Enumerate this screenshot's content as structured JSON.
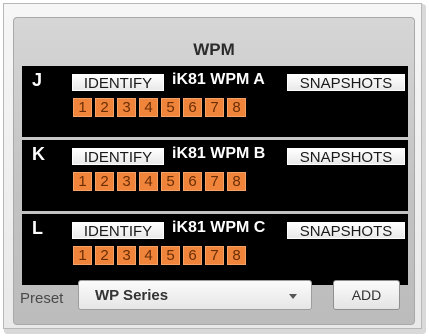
{
  "panel": {
    "title": "WPM"
  },
  "devices": [
    {
      "letter": "J",
      "identify_label": "IDENTIFY",
      "name": "iK81 WPM A",
      "snapshots_label": "SNAPSHOTS",
      "channels": [
        "1",
        "2",
        "3",
        "4",
        "5",
        "6",
        "7",
        "8"
      ]
    },
    {
      "letter": "K",
      "identify_label": "IDENTIFY",
      "name": "iK81 WPM B",
      "snapshots_label": "SNAPSHOTS",
      "channels": [
        "1",
        "2",
        "3",
        "4",
        "5",
        "6",
        "7",
        "8"
      ]
    },
    {
      "letter": "L",
      "identify_label": "IDENTIFY",
      "name": "iK81 WPM C",
      "snapshots_label": "SNAPSHOTS",
      "channels": [
        "1",
        "2",
        "3",
        "4",
        "5",
        "6",
        "7",
        "8"
      ]
    }
  ],
  "footer": {
    "preset_label": "Preset",
    "preset_selected": "WP Series",
    "add_label": "ADD"
  },
  "colors": {
    "channel_fill": "#f0843a",
    "device_bar": "#000000",
    "frame": "#c3c3c3"
  }
}
